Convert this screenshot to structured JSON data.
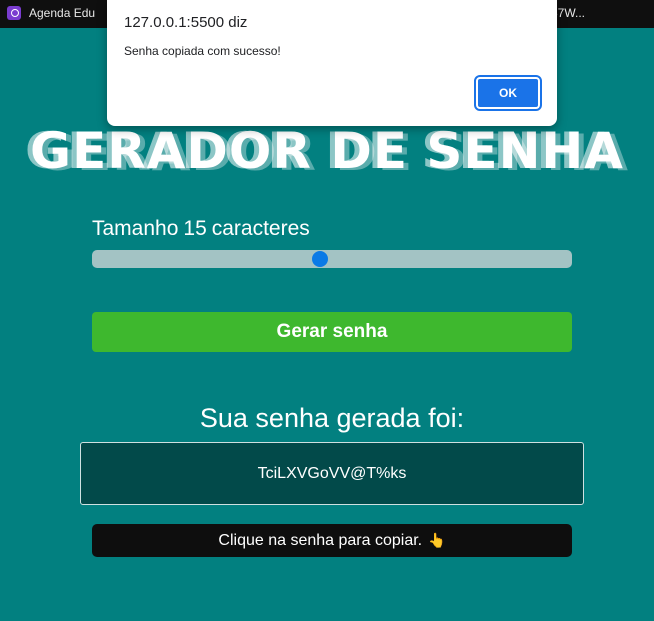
{
  "bookmarks_bar": {
    "left_label": "Agenda Edu",
    "right_label": "37W..."
  },
  "dialog": {
    "origin": "127.0.0.1:5500 diz",
    "message": "Senha copiada com sucesso!",
    "ok_label": "OK"
  },
  "app": {
    "title": "GERADOR DE SENHA",
    "size_label_prefix": "Tamanho",
    "size_value": "15",
    "size_label_suffix": "caracteres",
    "slider": {
      "value": 15,
      "min": 6,
      "max": 25
    },
    "generate_label": "Gerar senha",
    "result_title": "Sua senha gerada foi:",
    "password": "TciLXVGoVV@T%ks",
    "tooltip_text": "Clique na senha para copiar.",
    "tooltip_icon": "👆"
  },
  "colors": {
    "background": "#028080",
    "button": "#3eb82e",
    "password_box": "#024a4a",
    "slider_thumb": "#0a7ae6",
    "dialog_ok": "#1a73e8"
  }
}
